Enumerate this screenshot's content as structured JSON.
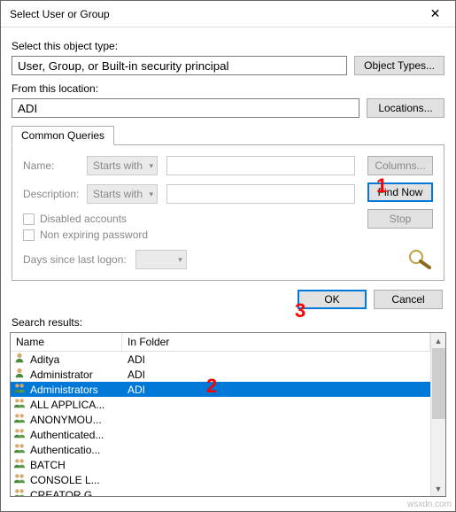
{
  "window": {
    "title": "Select User or Group",
    "close_glyph": "✕"
  },
  "labels": {
    "object_type": "Select this object type:",
    "from_location": "From this location:",
    "tab": "Common Queries",
    "name": "Name:",
    "description": "Description:",
    "disabled": "Disabled accounts",
    "nonexp": "Non expiring password",
    "days": "Days since last logon:",
    "results": "Search results:",
    "col_name": "Name",
    "col_folder": "In Folder"
  },
  "inputs": {
    "object_type_value": "User, Group, or Built-in security principal",
    "location_value": "ADI",
    "name_mode": "Starts with",
    "desc_mode": "Starts with"
  },
  "buttons": {
    "object_types": "Object Types...",
    "locations": "Locations...",
    "columns": "Columns...",
    "find_now": "Find Now",
    "stop": "Stop",
    "ok": "OK",
    "cancel": "Cancel"
  },
  "results": [
    {
      "name": "Aditya",
      "folder": "ADI",
      "type": "user",
      "selected": false
    },
    {
      "name": "Administrator",
      "folder": "ADI",
      "type": "user",
      "selected": false
    },
    {
      "name": "Administrators",
      "folder": "ADI",
      "type": "group",
      "selected": true
    },
    {
      "name": "ALL APPLICA...",
      "folder": "",
      "type": "group",
      "selected": false
    },
    {
      "name": "ANONYMOU...",
      "folder": "",
      "type": "group",
      "selected": false
    },
    {
      "name": "Authenticated...",
      "folder": "",
      "type": "group",
      "selected": false
    },
    {
      "name": "Authenticatio...",
      "folder": "",
      "type": "group",
      "selected": false
    },
    {
      "name": "BATCH",
      "folder": "",
      "type": "group",
      "selected": false
    },
    {
      "name": "CONSOLE L...",
      "folder": "",
      "type": "group",
      "selected": false
    },
    {
      "name": "CREATOR G...",
      "folder": "",
      "type": "group",
      "selected": false
    }
  ],
  "annotations": {
    "a1": "1",
    "a2": "2",
    "a3": "3"
  },
  "watermark": "wsxdn.com"
}
